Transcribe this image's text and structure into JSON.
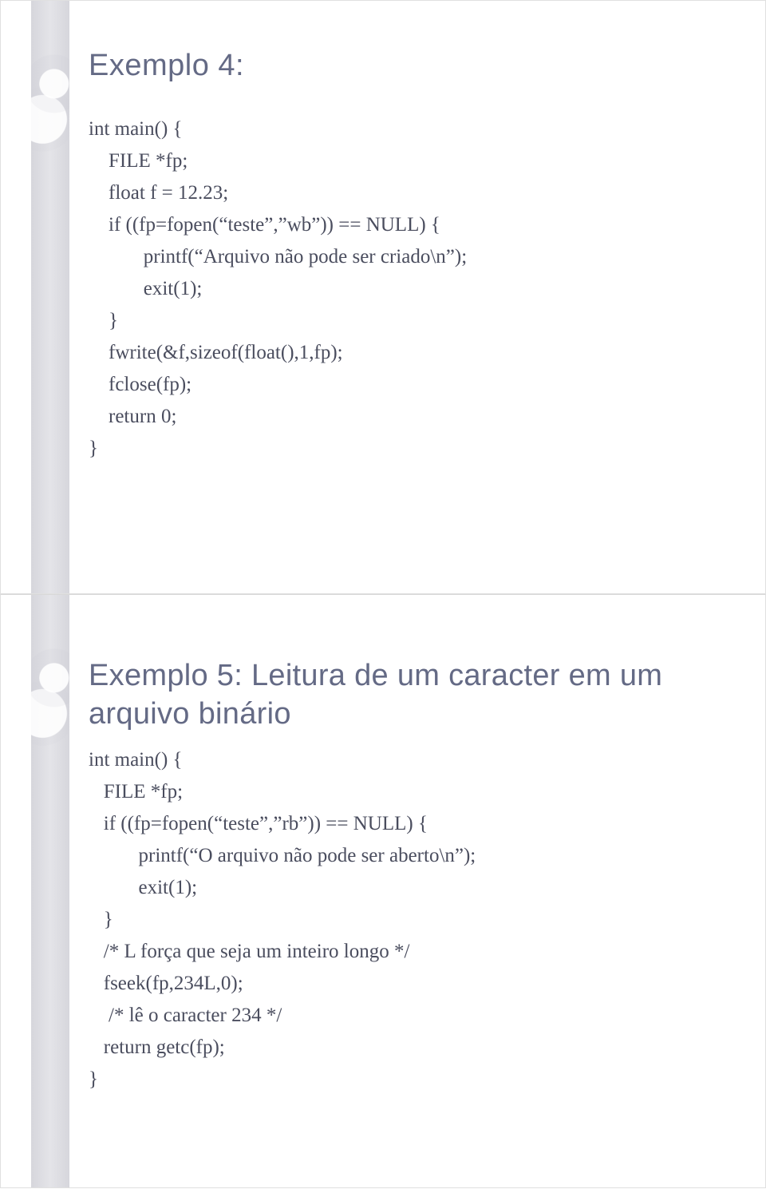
{
  "slide1": {
    "title": "Exemplo 4:",
    "codeLines": [
      "int main() {",
      "    FILE *fp;",
      "    float f = 12.23;",
      "    if ((fp=fopen(“teste”,”wb”)) == NULL) {",
      "           printf(“Arquivo não pode ser criado\\n”);",
      "           exit(1);",
      "    }",
      "    fwrite(&f,sizeof(float(),1,fp);",
      "    fclose(fp);",
      "    return 0;",
      "}"
    ]
  },
  "slide2": {
    "title": "Exemplo 5: Leitura de um caracter em um arquivo binário",
    "codeLines": [
      "int main() {",
      "   FILE *fp;",
      "   if ((fp=fopen(“teste”,”rb”)) == NULL) {",
      "          printf(“O arquivo não pode ser aberto\\n”);",
      "          exit(1);",
      "   }",
      "   /* L força que seja um inteiro longo */",
      "   fseek(fp,234L,0);",
      "    /* lê o caracter 234 */",
      "   return getc(fp);",
      "}"
    ]
  }
}
